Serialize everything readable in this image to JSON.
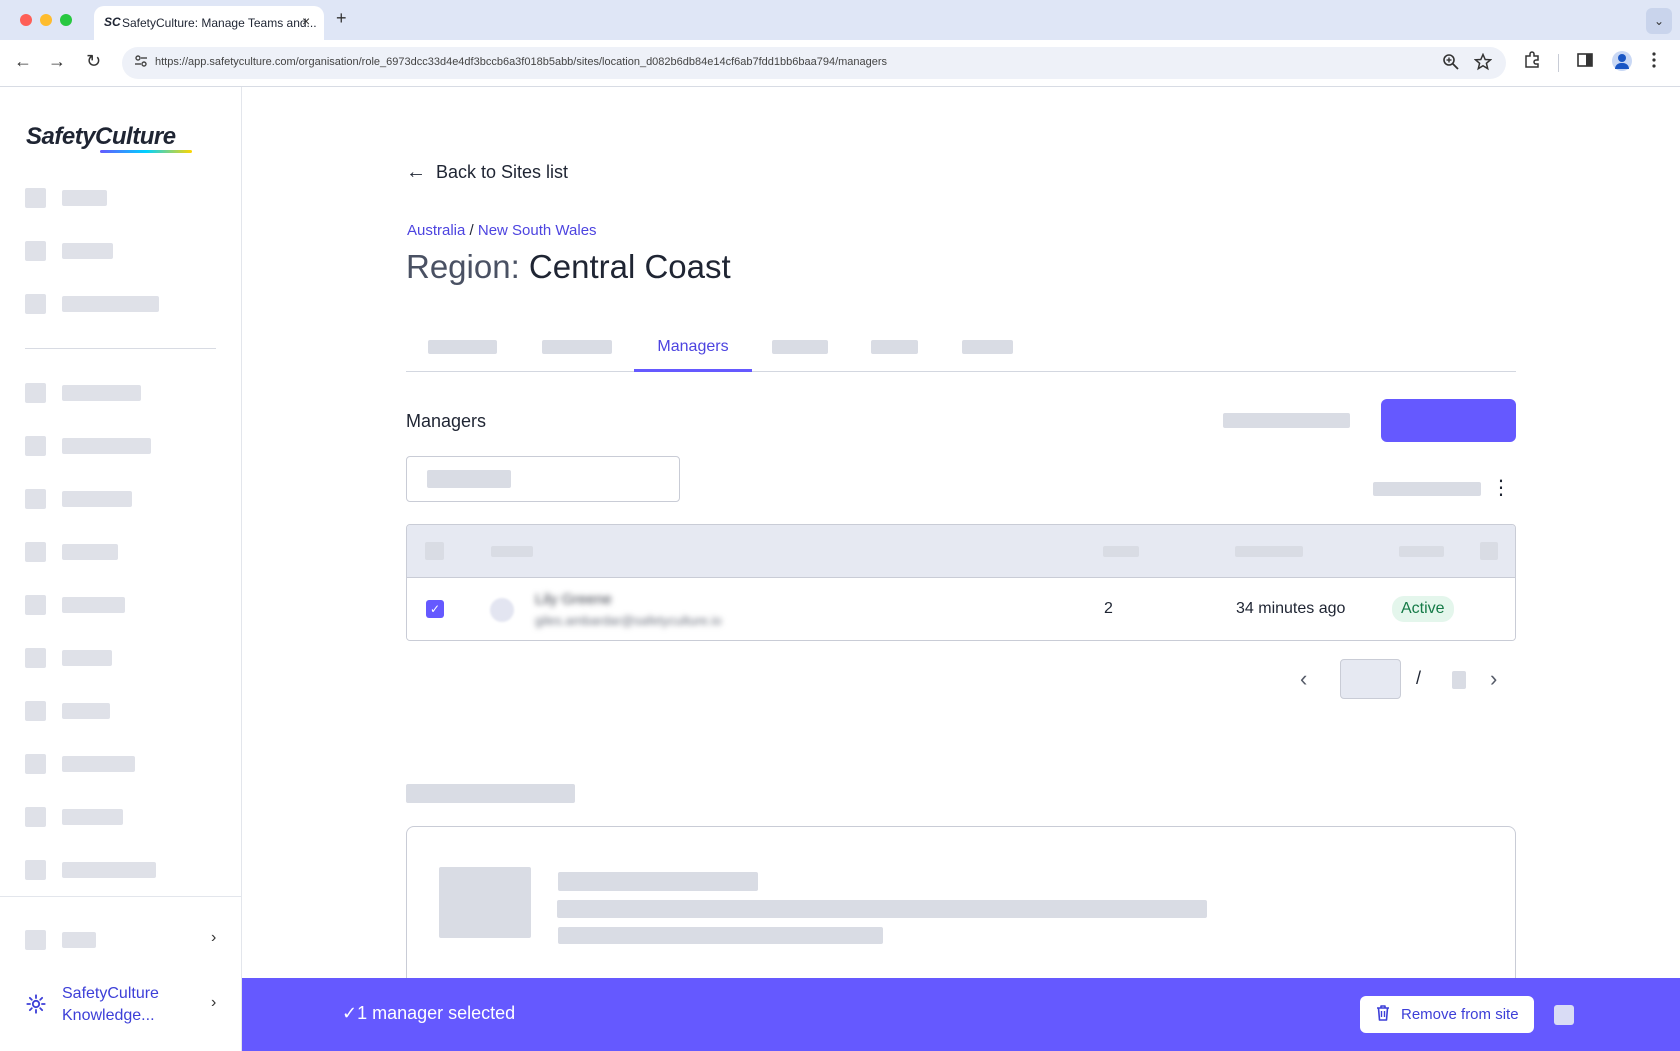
{
  "browser": {
    "tab_icon": "SC",
    "tab_title": "SafetyCulture: Manage Teams and...",
    "tab_close": "×",
    "new_tab": "+",
    "tab_menu": "⌄",
    "url": "https://app.safetyculture.com/organisation/role_6973dcc33d4e4df3bccb6a3f018b5abb/sites/location_d082b6db84e14cf6ab7fdd1bb6baa794/managers",
    "nav": {
      "back": "←",
      "forward": "→",
      "reload": "↻"
    },
    "icons": [
      "zoom-icon",
      "star-icon",
      "extensions-icon",
      "sidepanel-icon",
      "profile-icon",
      "menu-icon"
    ]
  },
  "sidebar": {
    "logo": "SafetyCulture",
    "knowledge_label": "SafetyCulture Knowledge...",
    "chevron": "›"
  },
  "main": {
    "back_label": "Back to Sites list",
    "back_arrow": "←",
    "breadcrumb": {
      "first": "Australia",
      "separator": " / ",
      "second": "New South Wales"
    },
    "title_prefix": "Region: ",
    "title_name": "Central Coast",
    "active_tab": "Managers",
    "section_title": "Managers",
    "kebab": "⋮",
    "table": {
      "row": {
        "checked": true,
        "check_mark": "✓",
        "name_blurred": "Lily Greene",
        "email_blurred": "giles.ambardar@safetyculture.io",
        "count": "2",
        "last_active": "34 minutes ago",
        "status": "Active"
      }
    },
    "pager": {
      "prev": "‹",
      "slash": "/",
      "next": "›"
    }
  },
  "selection_bar": {
    "text": "✓1 manager selected",
    "remove_label": "Remove from site"
  },
  "colors": {
    "accent": "#6559ff",
    "link": "#4d44e0",
    "active_badge_bg": "#e4f6ec",
    "active_badge_text": "#157a47"
  }
}
